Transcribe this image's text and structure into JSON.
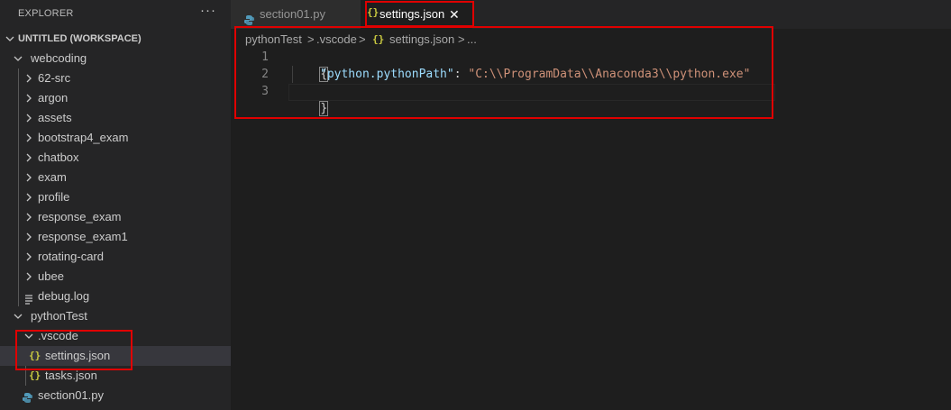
{
  "explorer": {
    "title": "EXPLORER",
    "more_icon": "ellipsis-icon",
    "workspace_label": "UNTITLED (WORKSPACE)"
  },
  "tree": {
    "webcoding": "webcoding",
    "folders": [
      "62-src",
      "argon",
      "assets",
      "bootstrap4_exam",
      "chatbox",
      "exam",
      "profile",
      "response_exam",
      "response_exam1",
      "rotating-card",
      "ubee"
    ],
    "debug_log": "debug.log",
    "pythontest": "pythonTest",
    "vscode": ".vscode",
    "settings_json": "settings.json",
    "tasks_json": "tasks.json",
    "section01_py": "section01.py"
  },
  "tabs": [
    {
      "label": "section01.py",
      "icon": "python-file-icon"
    },
    {
      "label": "settings.json",
      "icon": "json-file-icon",
      "active": true
    }
  ],
  "breadcrumb": {
    "part1": "pythonTest",
    "part2": ".vscode",
    "part3": "settings.json",
    "part4": "...",
    "sep": ">"
  },
  "editor": {
    "line_numbers": [
      "1",
      "2",
      "3"
    ],
    "line1": "{",
    "key": "\"python.pythonPath\"",
    "colon": ": ",
    "value": "\"C:\\\\ProgramData\\\\Anaconda3\\\\python.exe\"",
    "line3": "}"
  },
  "icons": {
    "json": "{}",
    "close": "✕"
  },
  "colors": {
    "highlight_box": "#e00000",
    "json_icon": "#cbcb41",
    "python_icon": "#519aba",
    "json_key": "#9cdcfe",
    "json_string": "#ce9178"
  }
}
